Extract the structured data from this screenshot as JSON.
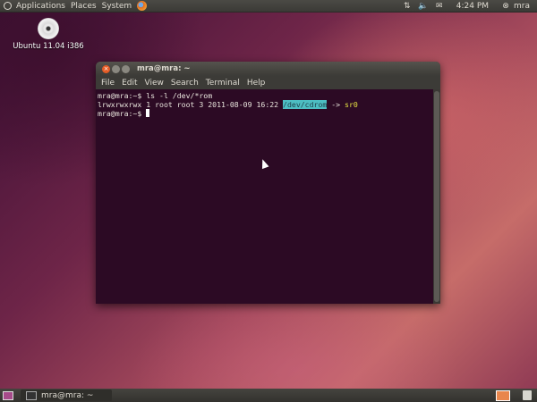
{
  "top_panel": {
    "menus": [
      "Applications",
      "Places",
      "System"
    ],
    "clock": "4:24 PM",
    "user": "mra",
    "icons": [
      "network-icon",
      "volume-icon",
      "mail-icon",
      "power-icon"
    ]
  },
  "desktop": {
    "icon_label": "Ubuntu 11.04 i386"
  },
  "terminal": {
    "title": "mra@mra: ~",
    "menus": [
      "File",
      "Edit",
      "View",
      "Search",
      "Terminal",
      "Help"
    ],
    "lines": {
      "cmd": "mra@mra:~$ ls -l /dev/*rom",
      "out_prefix": "lrwxrwxrwx 1 root root 3 2011-08-09 16:22 ",
      "out_dir": "/dev/cdrom",
      "out_arrow": " -> ",
      "out_target": "sr0",
      "prompt": "mra@mra:~$ "
    }
  },
  "bottom_panel": {
    "task_label": "mra@mra: ~"
  },
  "colors": {
    "accent": "#e65c26",
    "terminal_bg": "#2c0a24"
  }
}
